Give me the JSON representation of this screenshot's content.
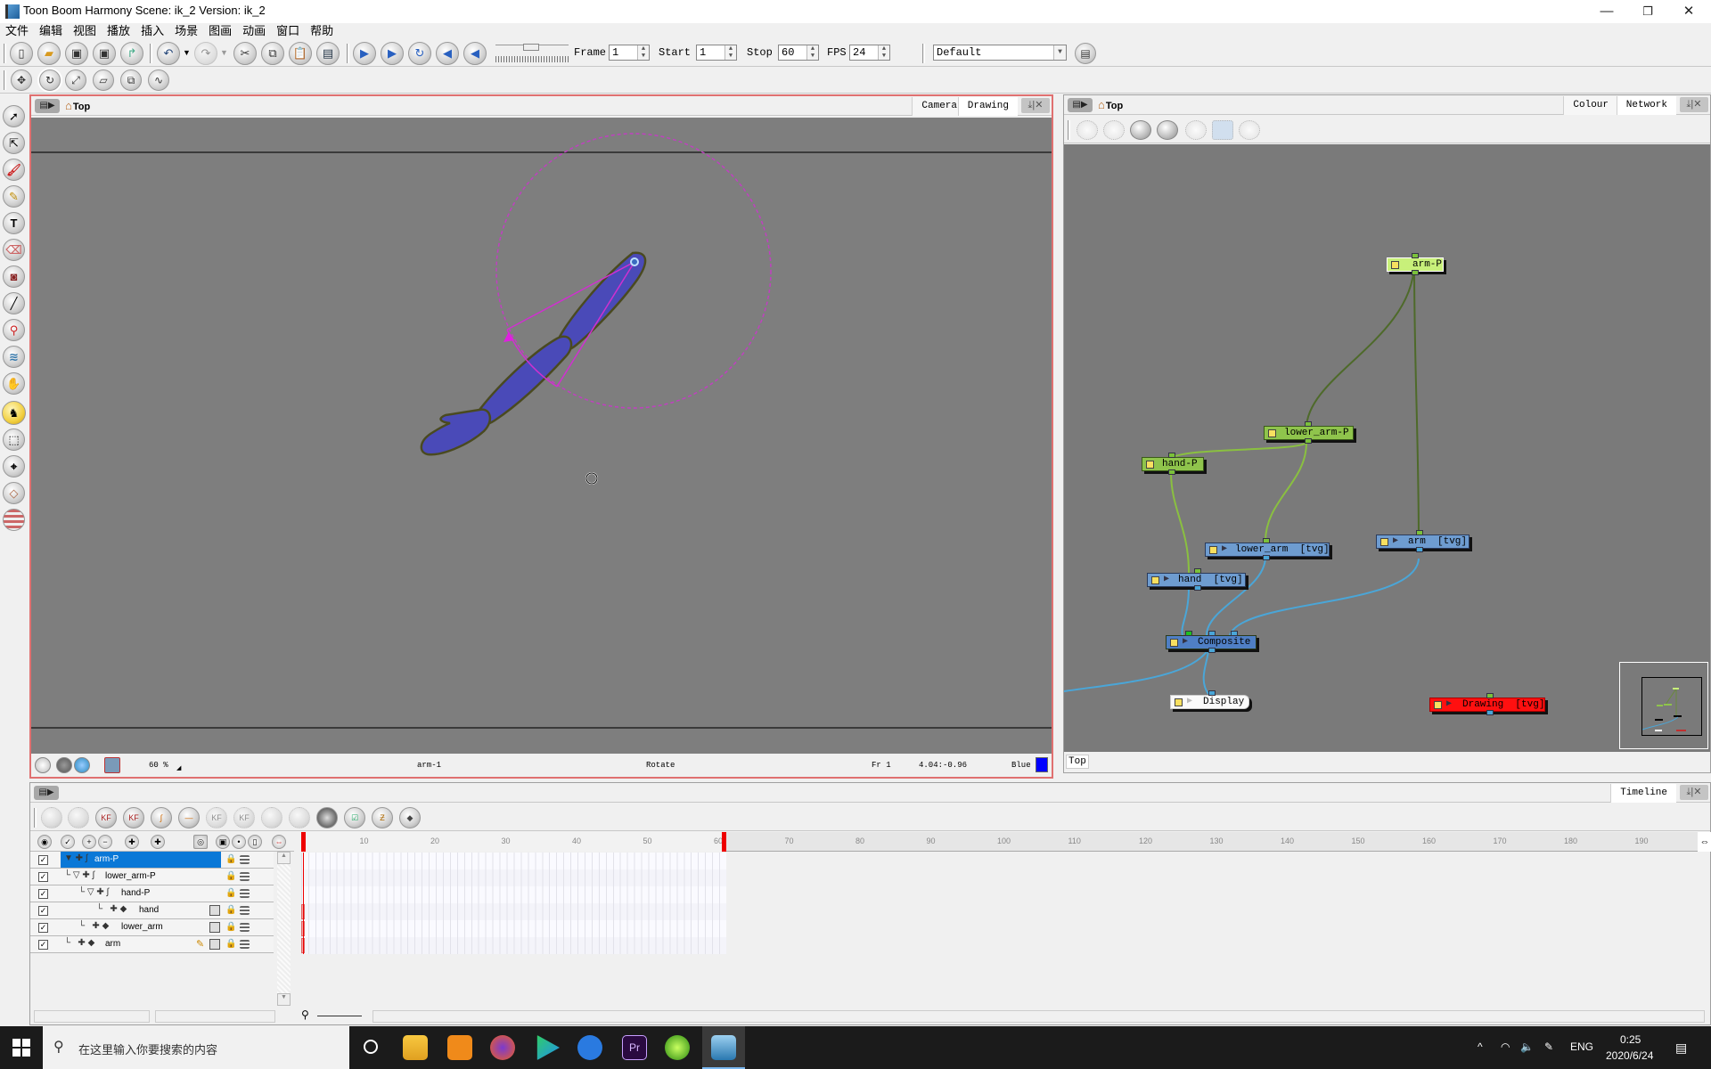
{
  "window": {
    "title": "Toon Boom Harmony Scene: ik_2 Version: ik_2",
    "controls": {
      "minimize": "—",
      "restore": "❐",
      "close": "✕"
    }
  },
  "menu": [
    "文件",
    "编辑",
    "视图",
    "播放",
    "插入",
    "场景",
    "图画",
    "动画",
    "窗口",
    "帮助"
  ],
  "toolbar": {
    "file_buttons": [
      "new-icon",
      "open-icon",
      "save-icon",
      "save-as-icon",
      "import-icon"
    ],
    "edit_buttons": [
      "undo-icon",
      "redo-icon",
      "cut-icon",
      "copy-icon",
      "paste-icon",
      "library-icon"
    ],
    "playback_buttons": [
      "play-icon",
      "render-play-icon",
      "loop-icon",
      "sound-icon",
      "sound-scrub-icon"
    ],
    "frame_label": "Frame",
    "frame_value": "1",
    "start_label": "Start",
    "start_value": "1",
    "stop_label": "Stop",
    "stop_value": "60",
    "fps_label": "FPS",
    "fps_value": "24",
    "workspace_value": "Default",
    "transform_buttons": [
      "transform-icon",
      "rotate-icon",
      "scale-icon",
      "skew-icon",
      "maintain-size-icon",
      "morph-icon"
    ]
  },
  "tools": [
    "select-icon",
    "contour-editor-icon",
    "brush-icon",
    "pencil-icon",
    "text-icon",
    "eraser-icon",
    "paint-bucket-icon",
    "line-icon",
    "dropper-icon",
    "stroke-icon",
    "hand-icon",
    "inverse-kinematics-icon",
    "transform-box-icon",
    "pivot-icon",
    "morph-icon",
    "zoom-stack-icon"
  ],
  "camera_view": {
    "breadcrumb": "Top",
    "tabs": [
      "Camera",
      "Drawing"
    ],
    "status": {
      "zoom": "60 %",
      "selection": "arm-1",
      "tool": "Rotate",
      "frame": "Fr 1",
      "coords": "4.04:-0.96",
      "colour_name": "Blue",
      "colour_hex": "#0000ff"
    }
  },
  "network_view": {
    "breadcrumb": "Top",
    "tabs": [
      "Colour",
      "Network"
    ],
    "footer_path": "Top",
    "nodes": [
      {
        "id": "arm-P",
        "label": "arm-P",
        "type": "peg",
        "selected": true
      },
      {
        "id": "lower_arm-P",
        "label": "lower_arm-P",
        "type": "peg"
      },
      {
        "id": "hand-P",
        "label": "hand-P",
        "type": "peg"
      },
      {
        "id": "lower_arm",
        "label": "lower_arm  [tvg]",
        "type": "read"
      },
      {
        "id": "arm",
        "label": "arm  [tvg]",
        "type": "read"
      },
      {
        "id": "hand",
        "label": "hand  [tvg]",
        "type": "read"
      },
      {
        "id": "Composite",
        "label": "Composite",
        "type": "composite"
      },
      {
        "id": "Display",
        "label": "Display",
        "type": "display"
      },
      {
        "id": "Drawing",
        "label": "Drawing  [tvg]",
        "type": "read-error"
      }
    ]
  },
  "timeline": {
    "title": "Timeline",
    "layers": [
      {
        "name": "arm-P",
        "checked": true,
        "selected": true,
        "kind": "peg"
      },
      {
        "name": "lower_arm-P",
        "checked": true,
        "kind": "peg"
      },
      {
        "name": "hand-P",
        "checked": true,
        "kind": "peg"
      },
      {
        "name": "hand",
        "checked": true,
        "kind": "drawing"
      },
      {
        "name": "lower_arm",
        "checked": true,
        "kind": "drawing"
      },
      {
        "name": "arm",
        "checked": true,
        "kind": "drawing",
        "editing": true
      }
    ],
    "ruler_ticks": [
      "10",
      "20",
      "30",
      "40",
      "50",
      "60",
      "70",
      "80",
      "90",
      "100",
      "110",
      "120",
      "130",
      "140",
      "150",
      "160",
      "170",
      "180",
      "190"
    ],
    "current_frame": 1,
    "scene_length": 60
  },
  "taskbar": {
    "search_placeholder": "在这里输入你要搜索的内容",
    "apps": [
      "cortana-icon",
      "file-explorer-icon",
      "uc-browser-icon",
      "firefox-icon",
      "video-player-icon",
      "sogou-icon",
      "premiere-icon",
      "green-app-icon",
      "toon-boom-icon"
    ],
    "language": "ENG",
    "time": "0:25",
    "date": "2020/6/24"
  }
}
